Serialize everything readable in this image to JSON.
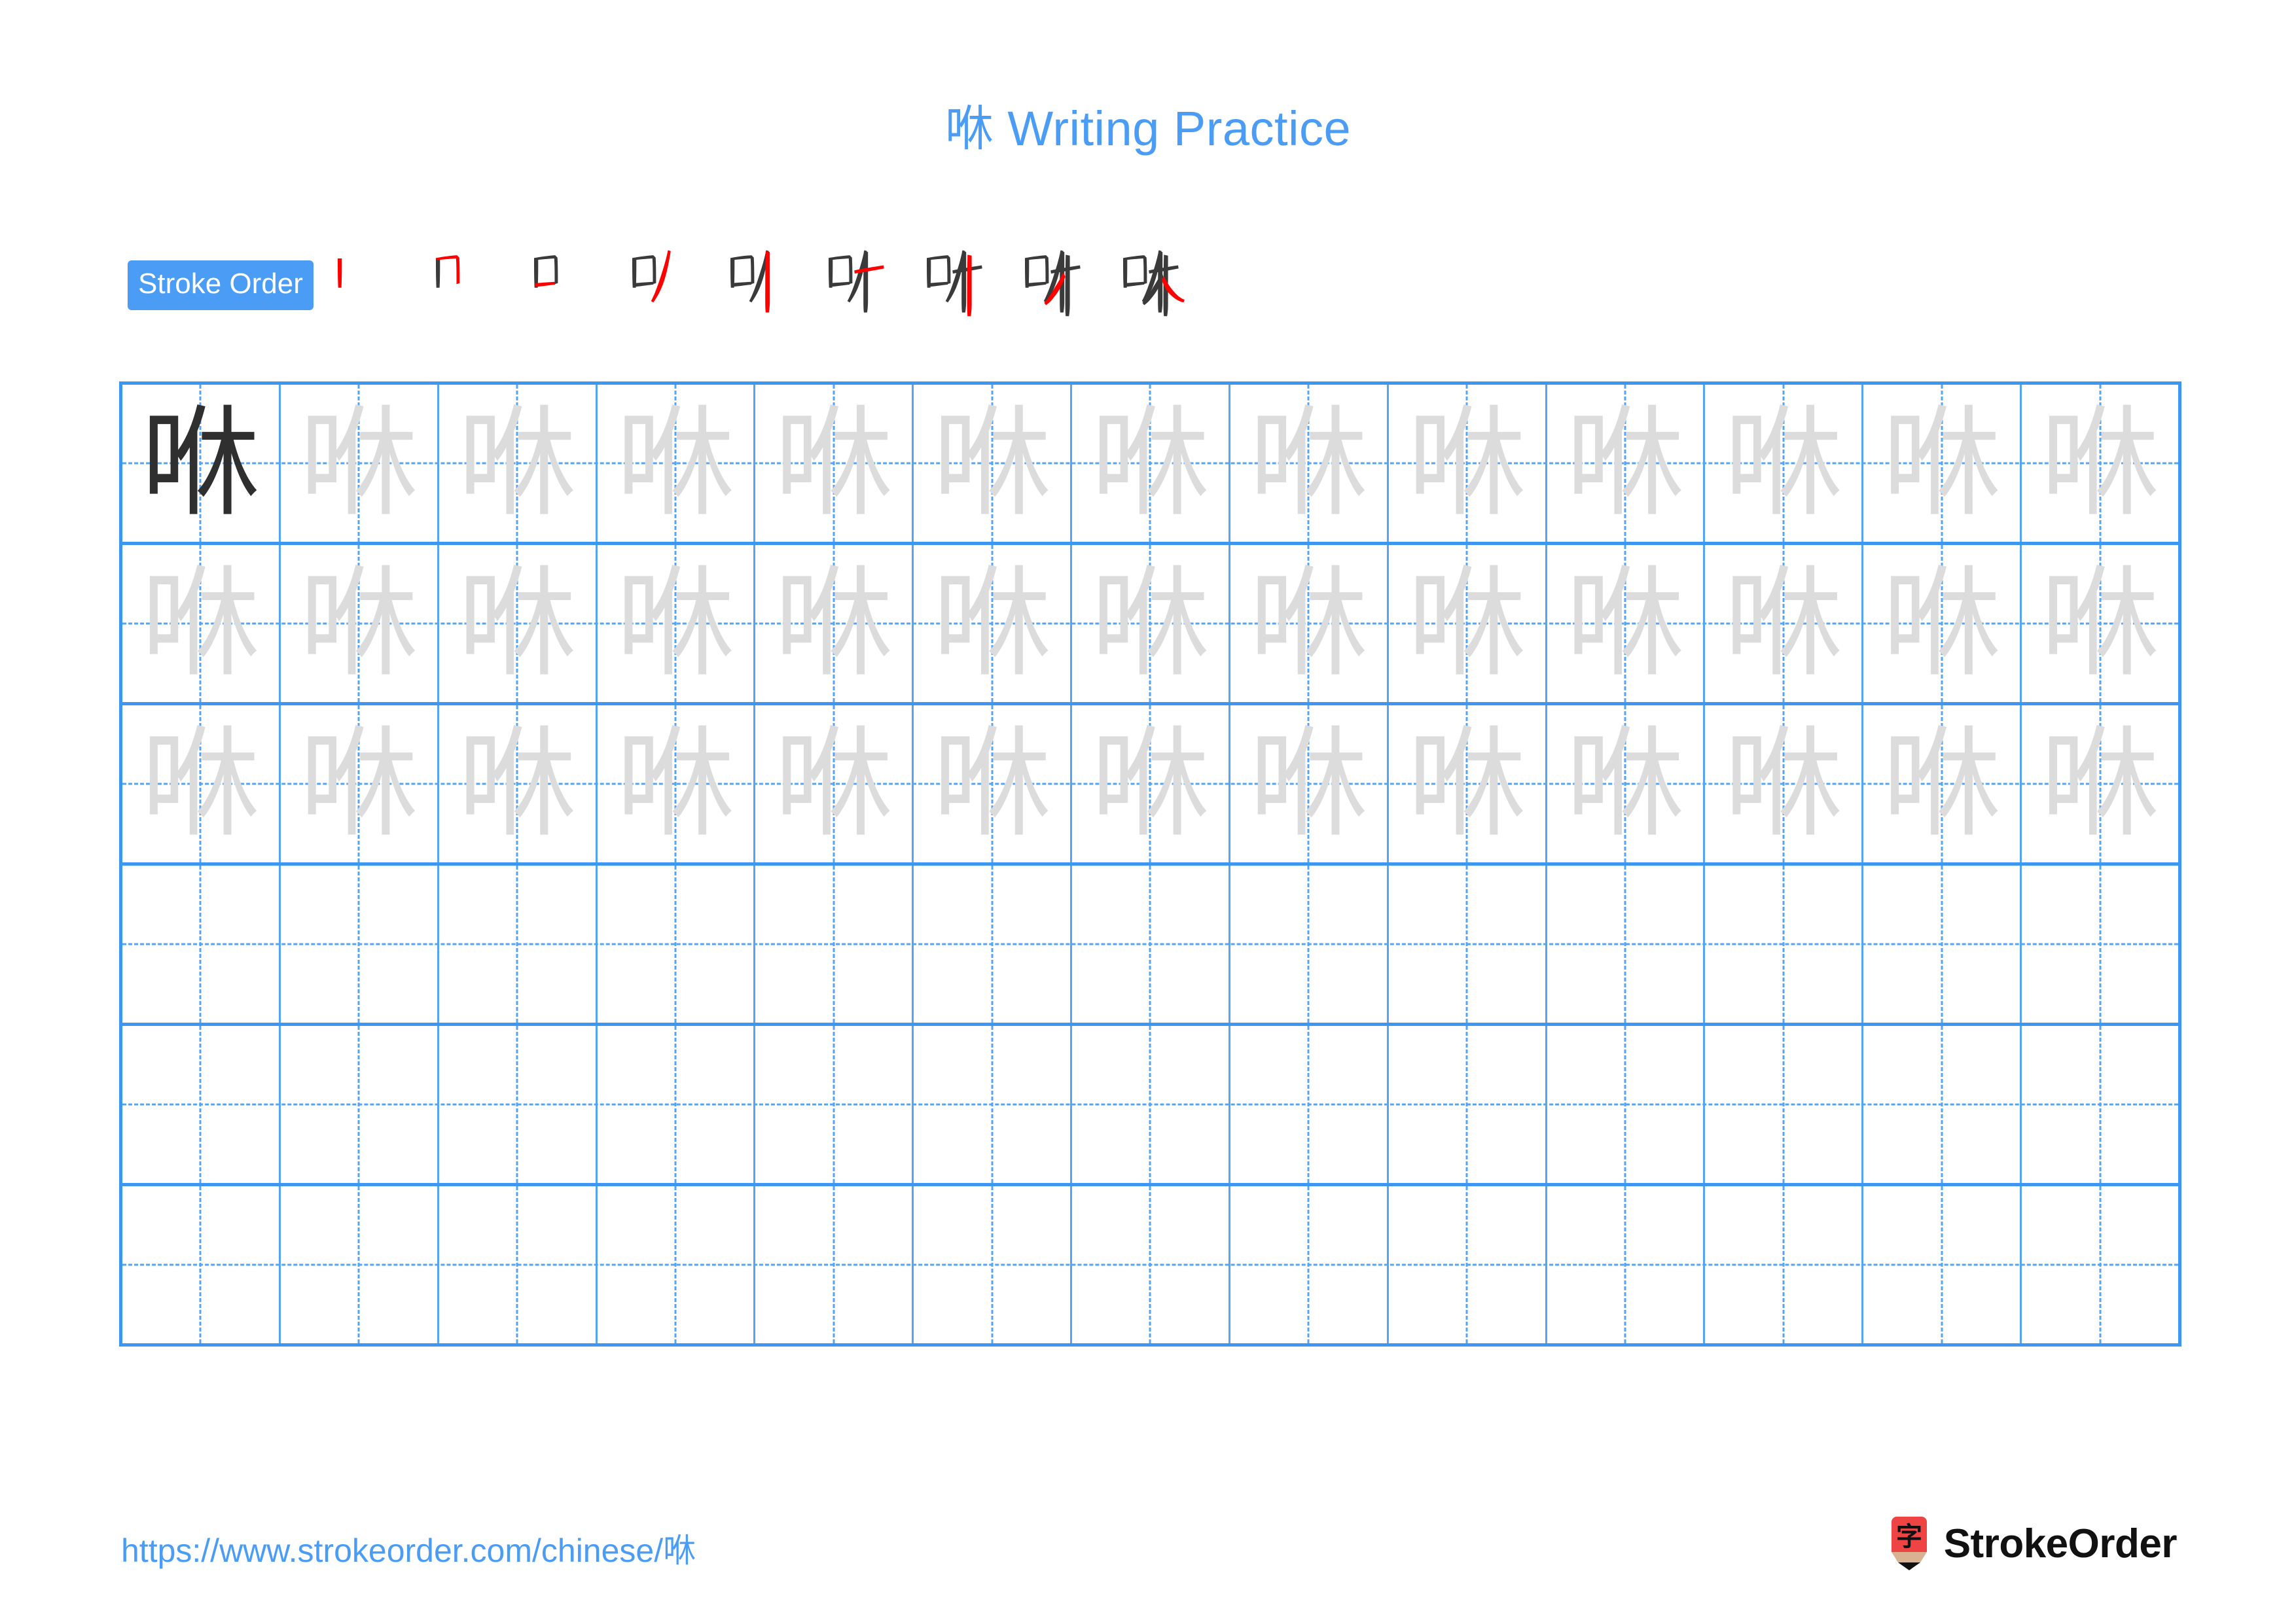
{
  "character": "咻",
  "title": {
    "character": "咻",
    "text": " Writing Practice",
    "full": "咻 Writing Practice"
  },
  "colors": {
    "title_blue": "#4a9cf5",
    "badge_blue": "#4a9cf5",
    "grid_line": "#3d97f2",
    "grid_guide": "#56a5f4",
    "stroke_new": "#ff0000",
    "stroke_done": "#3a3a3a",
    "trace_gray": "#dcdcdc",
    "model_dark": "#2f2f2f",
    "logo_red": "#ef4444",
    "logo_wood": "#d9b391"
  },
  "stroke_order": {
    "label": "Stroke Order",
    "total_strokes": 9,
    "steps": [
      {
        "index": 1,
        "strokes_shown": 1,
        "new_stroke": "丨 (vertical)"
      },
      {
        "index": 2,
        "strokes_shown": 2,
        "new_stroke": "𠃌 (horizontal-turn)"
      },
      {
        "index": 3,
        "strokes_shown": 3,
        "new_stroke": "一 (horizontal close)"
      },
      {
        "index": 4,
        "strokes_shown": 4,
        "new_stroke": "丿 (left-falling)"
      },
      {
        "index": 5,
        "strokes_shown": 5,
        "new_stroke": "丨 (vertical)"
      },
      {
        "index": 6,
        "strokes_shown": 6,
        "new_stroke": "一 (horizontal)"
      },
      {
        "index": 7,
        "strokes_shown": 7,
        "new_stroke": "丨 (vertical)"
      },
      {
        "index": 8,
        "strokes_shown": 8,
        "new_stroke": "丿 (left-falling)"
      },
      {
        "index": 9,
        "strokes_shown": 9,
        "new_stroke": "㇏ (right-falling)"
      }
    ]
  },
  "grid": {
    "columns": 13,
    "rows": 6,
    "cells": [
      [
        {
          "char": "咻",
          "style": "dark"
        },
        {
          "char": "咻",
          "style": "trace"
        },
        {
          "char": "咻",
          "style": "trace"
        },
        {
          "char": "咻",
          "style": "trace"
        },
        {
          "char": "咻",
          "style": "trace"
        },
        {
          "char": "咻",
          "style": "trace"
        },
        {
          "char": "咻",
          "style": "trace"
        },
        {
          "char": "咻",
          "style": "trace"
        },
        {
          "char": "咻",
          "style": "trace"
        },
        {
          "char": "咻",
          "style": "trace"
        },
        {
          "char": "咻",
          "style": "trace"
        },
        {
          "char": "咻",
          "style": "trace"
        },
        {
          "char": "咻",
          "style": "trace"
        }
      ],
      [
        {
          "char": "咻",
          "style": "trace"
        },
        {
          "char": "咻",
          "style": "trace"
        },
        {
          "char": "咻",
          "style": "trace"
        },
        {
          "char": "咻",
          "style": "trace"
        },
        {
          "char": "咻",
          "style": "trace"
        },
        {
          "char": "咻",
          "style": "trace"
        },
        {
          "char": "咻",
          "style": "trace"
        },
        {
          "char": "咻",
          "style": "trace"
        },
        {
          "char": "咻",
          "style": "trace"
        },
        {
          "char": "咻",
          "style": "trace"
        },
        {
          "char": "咻",
          "style": "trace"
        },
        {
          "char": "咻",
          "style": "trace"
        },
        {
          "char": "咻",
          "style": "trace"
        }
      ],
      [
        {
          "char": "咻",
          "style": "trace"
        },
        {
          "char": "咻",
          "style": "trace"
        },
        {
          "char": "咻",
          "style": "trace"
        },
        {
          "char": "咻",
          "style": "trace"
        },
        {
          "char": "咻",
          "style": "trace"
        },
        {
          "char": "咻",
          "style": "trace"
        },
        {
          "char": "咻",
          "style": "trace"
        },
        {
          "char": "咻",
          "style": "trace"
        },
        {
          "char": "咻",
          "style": "trace"
        },
        {
          "char": "咻",
          "style": "trace"
        },
        {
          "char": "咻",
          "style": "trace"
        },
        {
          "char": "咻",
          "style": "trace"
        },
        {
          "char": "咻",
          "style": "trace"
        }
      ],
      [
        {
          "char": "",
          "style": "empty"
        },
        {
          "char": "",
          "style": "empty"
        },
        {
          "char": "",
          "style": "empty"
        },
        {
          "char": "",
          "style": "empty"
        },
        {
          "char": "",
          "style": "empty"
        },
        {
          "char": "",
          "style": "empty"
        },
        {
          "char": "",
          "style": "empty"
        },
        {
          "char": "",
          "style": "empty"
        },
        {
          "char": "",
          "style": "empty"
        },
        {
          "char": "",
          "style": "empty"
        },
        {
          "char": "",
          "style": "empty"
        },
        {
          "char": "",
          "style": "empty"
        },
        {
          "char": "",
          "style": "empty"
        }
      ],
      [
        {
          "char": "",
          "style": "empty"
        },
        {
          "char": "",
          "style": "empty"
        },
        {
          "char": "",
          "style": "empty"
        },
        {
          "char": "",
          "style": "empty"
        },
        {
          "char": "",
          "style": "empty"
        },
        {
          "char": "",
          "style": "empty"
        },
        {
          "char": "",
          "style": "empty"
        },
        {
          "char": "",
          "style": "empty"
        },
        {
          "char": "",
          "style": "empty"
        },
        {
          "char": "",
          "style": "empty"
        },
        {
          "char": "",
          "style": "empty"
        },
        {
          "char": "",
          "style": "empty"
        },
        {
          "char": "",
          "style": "empty"
        }
      ],
      [
        {
          "char": "",
          "style": "empty"
        },
        {
          "char": "",
          "style": "empty"
        },
        {
          "char": "",
          "style": "empty"
        },
        {
          "char": "",
          "style": "empty"
        },
        {
          "char": "",
          "style": "empty"
        },
        {
          "char": "",
          "style": "empty"
        },
        {
          "char": "",
          "style": "empty"
        },
        {
          "char": "",
          "style": "empty"
        },
        {
          "char": "",
          "style": "empty"
        },
        {
          "char": "",
          "style": "empty"
        },
        {
          "char": "",
          "style": "empty"
        },
        {
          "char": "",
          "style": "empty"
        },
        {
          "char": "",
          "style": "empty"
        }
      ]
    ]
  },
  "footer": {
    "url": "https://www.strokeorder.com/chinese/咻",
    "brand_name": "StrokeOrder",
    "brand_mark_char": "字"
  }
}
